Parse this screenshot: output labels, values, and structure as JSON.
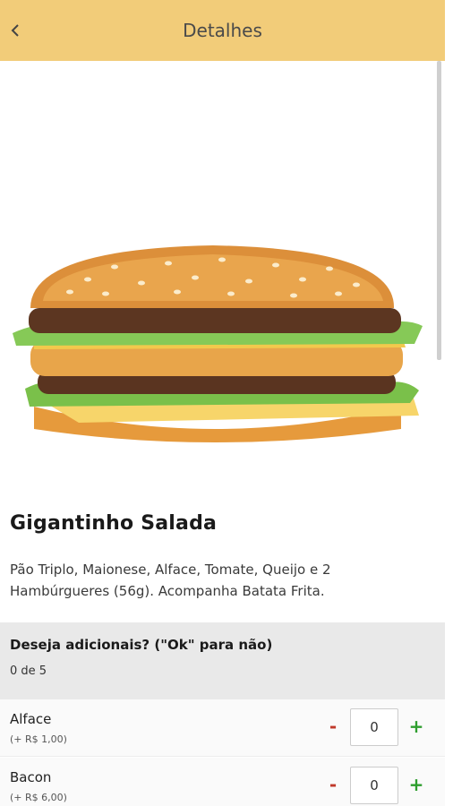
{
  "header": {
    "title": "Detalhes",
    "back_icon": "chevron-left-icon"
  },
  "product": {
    "image_alt": "burger-image",
    "name": "Gigantinho Salada",
    "description": "Pão Triplo, Maionese, Alface, Tomate, Queijo e 2 Hambúrgueres (56g). Acompanha Batata Frita."
  },
  "addons": {
    "title": "Deseja adicionais? (\"Ok\" para não)",
    "count": "0 de 5",
    "items": [
      {
        "name": "Alface",
        "price": "(+ R$ 1,00)",
        "qty": "0",
        "minus": "-",
        "plus": "+"
      },
      {
        "name": "Bacon",
        "price": "(+ R$ 6,00)",
        "qty": "0",
        "minus": "-",
        "plus": "+"
      }
    ]
  },
  "colors": {
    "header_bg": "#f2cc79",
    "minus": "#c0392b",
    "plus": "#2e9e2e",
    "section_bg": "#e9e9e9"
  }
}
